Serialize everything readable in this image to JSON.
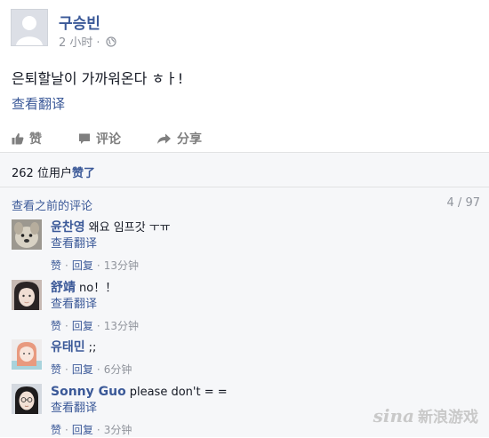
{
  "post": {
    "author": "구승빈",
    "time": "2 小时",
    "dot": "·",
    "text": "은퇴할날이 가까워온다 ㅎㅏ!",
    "translate": "查看翻译"
  },
  "actions": {
    "like": "赞",
    "comment": "评论",
    "share": "分享"
  },
  "likes": {
    "prefix": "262 位用户",
    "verb": "赞了"
  },
  "comments_header": {
    "view_previous": "查看之前的评论",
    "count": "4 / 97"
  },
  "comments": [
    {
      "author": "윤찬영",
      "text": "왜요 임프갓 ㅜㅠ",
      "translate": "查看翻译",
      "like": "赞",
      "reply": "回复",
      "sep": "·",
      "time": "13分钟"
    },
    {
      "author": "舒靖",
      "text": "no！！",
      "translate": "查看翻译",
      "like": "赞",
      "reply": "回复",
      "sep": "·",
      "time": "13分钟"
    },
    {
      "author": "유태민",
      "text": ";;",
      "like": "赞",
      "reply": "回复",
      "sep": "·",
      "time": "6分钟"
    },
    {
      "author": "Sonny Guo",
      "text": "please don't = =",
      "translate": "查看翻译",
      "like": "赞",
      "reply": "回复",
      "sep": "·",
      "time": "3分钟"
    }
  ],
  "watermark": {
    "logo": "sina",
    "text": "新浪游戏"
  },
  "colors": {
    "link": "#3b5998",
    "muted": "#90949c",
    "text": "#141823",
    "ufi_bg": "#f6f7f9"
  }
}
